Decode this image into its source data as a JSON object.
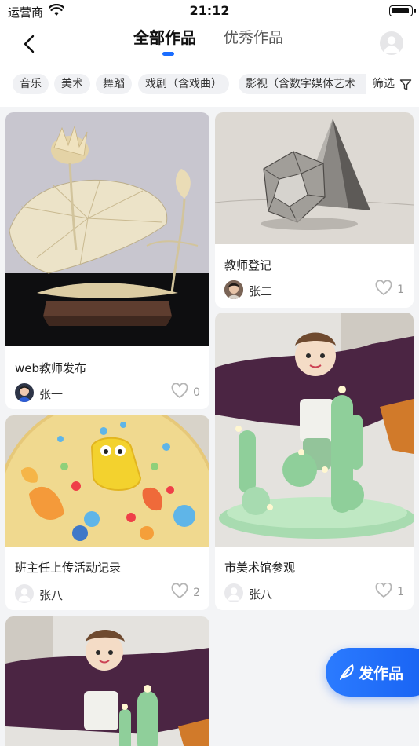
{
  "status_bar": {
    "carrier": "运营商",
    "time": "21:12"
  },
  "nav": {
    "back_icon": "chevron-left-icon",
    "tabs": [
      {
        "label": "全部作品",
        "active": true
      },
      {
        "label": "优秀作品",
        "active": false
      }
    ],
    "avatar_icon": "user-avatar-icon",
    "accent_color": "#1a6dff"
  },
  "filters": {
    "chips": [
      {
        "label": "音乐"
      },
      {
        "label": "美术"
      },
      {
        "label": "舞蹈"
      },
      {
        "label": "戏剧（含戏曲）"
      },
      {
        "label": "影视（含数字媒体艺术"
      }
    ],
    "filter_label": "筛选",
    "filter_icon": "funnel-icon"
  },
  "cards": [
    {
      "title": "web教师发布",
      "author": "张一",
      "likes": "0",
      "image": "paper-lotus-sculpture"
    },
    {
      "title": "教师登记",
      "author": "张二",
      "likes": "1",
      "image": "pencil-sketch-geometric-solids"
    },
    {
      "title": "市美术馆参观",
      "author": "张八",
      "likes": "1",
      "image": "clay-boy-with-cactus"
    },
    {
      "title": "班主任上传活动记录",
      "author": "张八",
      "likes": "2",
      "image": "clay-sponge-character-plate"
    },
    {
      "title": "",
      "author": "",
      "likes": "",
      "image": "clay-boy-with-cactus"
    }
  ],
  "fab": {
    "label": "发作品",
    "icon": "feather-icon"
  }
}
